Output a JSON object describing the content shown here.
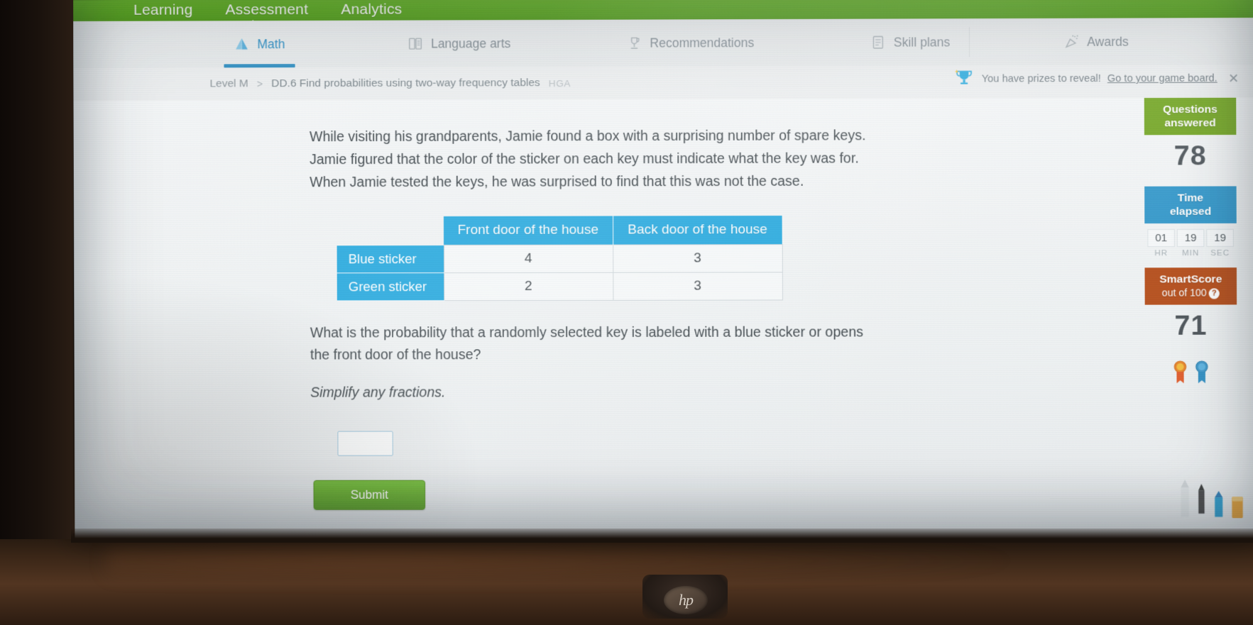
{
  "topnav": {
    "items": [
      {
        "label": "Learning",
        "active": true
      },
      {
        "label": "Assessment",
        "active": false
      },
      {
        "label": "Analytics",
        "active": false
      }
    ]
  },
  "tabs": [
    {
      "label": "Math",
      "icon": "pyramid-icon",
      "active": true
    },
    {
      "label": "Language arts",
      "icon": "book-icon",
      "active": false
    },
    {
      "label": "Recommendations",
      "icon": "trophy-stand-icon",
      "active": false
    },
    {
      "label": "Skill plans",
      "icon": "clipboard-icon",
      "active": false
    },
    {
      "label": "Awards",
      "icon": "confetti-icon",
      "active": false
    }
  ],
  "breadcrumb": {
    "level": "Level M",
    "separator": ">",
    "skill": "DD.6 Find probabilities using two-way frequency tables",
    "code": "HGA"
  },
  "prize_banner": {
    "icon": "trophy-icon",
    "message": "You have prizes to reveal!",
    "link": "Go to your game board.",
    "close": "✕"
  },
  "question": {
    "intro_line1": "While visiting his grandparents, Jamie found a box with a surprising number of spare keys.",
    "intro_line2": "Jamie figured that the color of the sticker on each key must indicate what the key was for.",
    "intro_line3": "When Jamie tested the keys, he was surprised to find that this was not the case.",
    "prompt_line1": "What is the probability that a randomly selected key is labeled with a blue sticker or opens",
    "prompt_line2": "the front door of the house?",
    "instruction": "Simplify any fractions.",
    "answer_value": "",
    "answer_placeholder": ""
  },
  "table": {
    "corner": "",
    "columns": [
      "Front door of the house",
      "Back door of the house"
    ],
    "rows": [
      {
        "label": "Blue sticker",
        "values": [
          "4",
          "3"
        ]
      },
      {
        "label": "Green sticker",
        "values": [
          "2",
          "3"
        ]
      }
    ]
  },
  "submit": {
    "label": "Submit"
  },
  "sidebar": {
    "questions": {
      "title_line1": "Questions",
      "title_line2": "answered",
      "value": "78"
    },
    "time": {
      "title_line1": "Time",
      "title_line2": "elapsed",
      "hr": "01",
      "min": "19",
      "sec": "19",
      "hr_label": "HR",
      "min_label": "MIN",
      "sec_label": "SEC"
    },
    "smartscore": {
      "title": "SmartScore",
      "subtitle": "out of 100",
      "help": "?",
      "value": "71"
    },
    "awards": [
      {
        "name": "ribbon-award-orange",
        "color": "#e06a20"
      },
      {
        "name": "ribbon-award-blue",
        "color": "#3e97c9"
      }
    ]
  },
  "colors": {
    "brand_green": "#57a718",
    "tab_blue": "#2e8ec2",
    "table_header_blue": "#26a9df",
    "smartscore_orange": "#b54c18",
    "questions_green": "#6fa31c"
  },
  "monitor": {
    "brand": "hp"
  }
}
